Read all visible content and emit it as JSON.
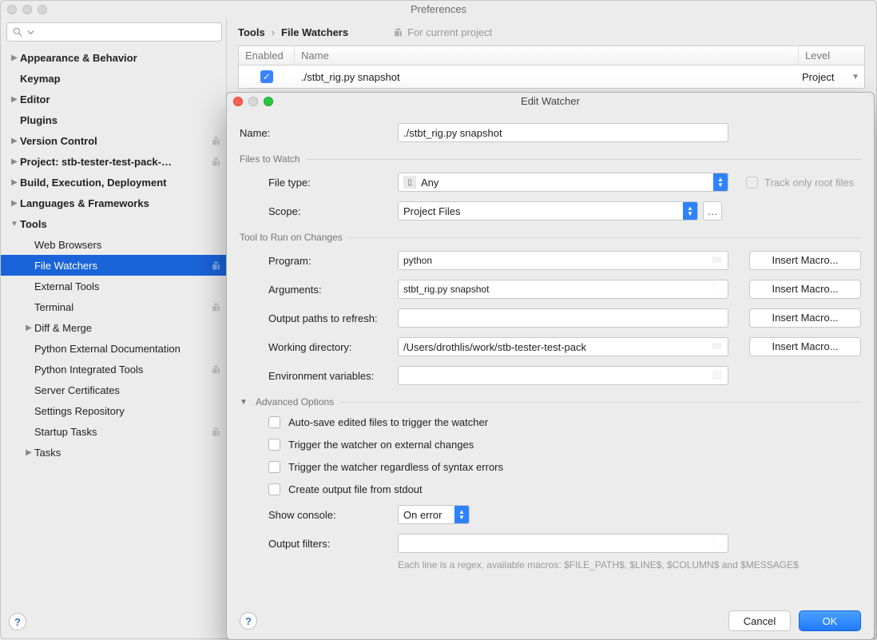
{
  "pref": {
    "title": "Preferences",
    "search_placeholder": "",
    "sidebar": [
      "Appearance & Behavior",
      "Keymap",
      "Editor",
      "Plugins",
      "Version Control",
      "Project: stb-tester-test-pack-…",
      "Build, Execution, Deployment",
      "Languages & Frameworks",
      "Tools",
      "Web Browsers",
      "File Watchers",
      "External Tools",
      "Terminal",
      "Diff & Merge",
      "Python External Documentation",
      "Python Integrated Tools",
      "Server Certificates",
      "Settings Repository",
      "Startup Tasks",
      "Tasks"
    ],
    "breadcrumb": {
      "a": "Tools",
      "b": "File Watchers"
    },
    "for_project": "For current project",
    "table": {
      "h_enabled": "Enabled",
      "h_name": "Name",
      "h_level": "Level",
      "r_name": "./stbt_rig.py snapshot",
      "r_level": "Project"
    }
  },
  "dlg": {
    "title": "Edit Watcher",
    "name_label": "Name:",
    "name_value": "./stbt_rig.py snapshot",
    "files_section": "Files to Watch",
    "file_type_label": "File type:",
    "file_type_value": "Any",
    "scope_label": "Scope:",
    "scope_value": "Project Files",
    "track_label": "Track only root files",
    "tool_section": "Tool to Run on Changes",
    "program_label": "Program:",
    "program_value": "python",
    "arguments_label": "Arguments:",
    "arguments_value": "stbt_rig.py snapshot",
    "output_label": "Output paths to refresh:",
    "output_value": "",
    "wd_label": "Working directory:",
    "wd_value": "/Users/drothlis/work/stb-tester-test-pack",
    "env_label": "Environment variables:",
    "env_value": "",
    "macro_btn": "Insert Macro...",
    "adv_section": "Advanced Options",
    "adv_opts": [
      "Auto-save edited files to trigger the watcher",
      "Trigger the watcher on external changes",
      "Trigger the watcher regardless of syntax errors",
      "Create output file from stdout"
    ],
    "show_console_label": "Show console:",
    "show_console_value": "On error",
    "filters_label": "Output filters:",
    "filters_value": "",
    "hint": "Each line is a regex, available macros: $FILE_PATH$, $LINE$, $COLUMN$ and $MESSAGE$",
    "cancel": "Cancel",
    "ok": "OK"
  }
}
